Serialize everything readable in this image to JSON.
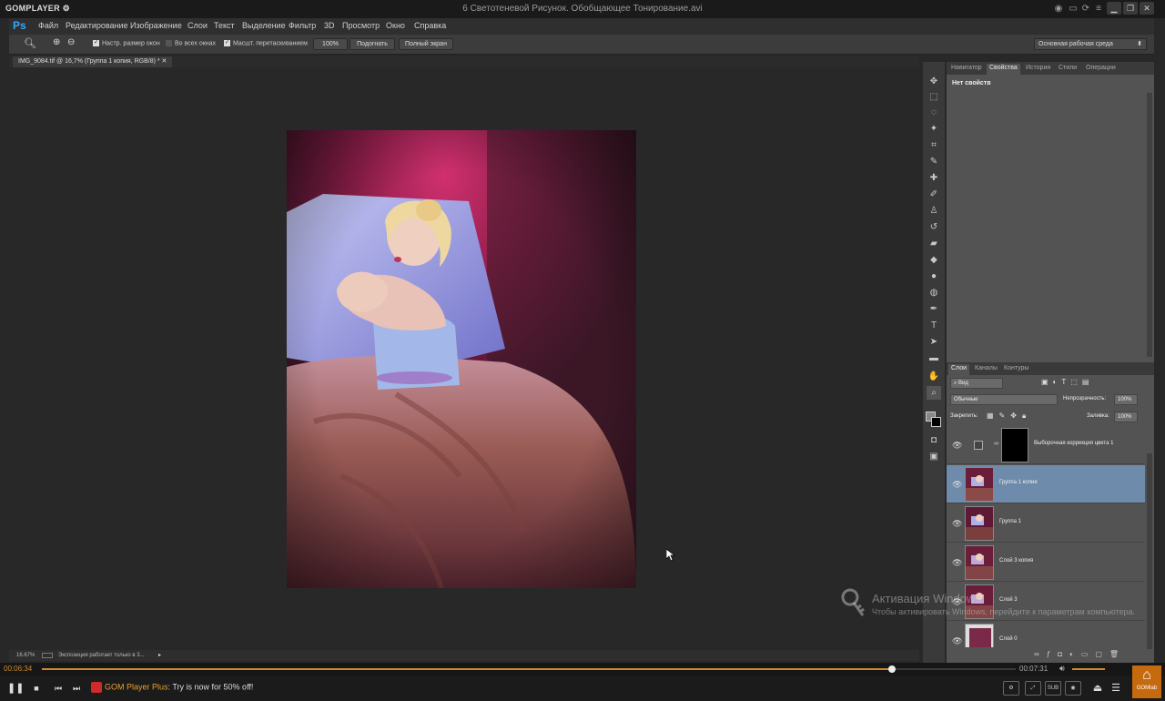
{
  "gom": {
    "logo": "GOMPLAYER ⚙",
    "file_title": "6 Светотеневой Рисунок. Обобщающее Тонирование.avi",
    "time_current": "00:06:34",
    "time_total": "00:07:31",
    "progress": 0.873,
    "promo_brand": "GOM Player Plus",
    "promo_text": ": Try is now for 50% off!",
    "gomlab_label": "GOMlab",
    "sub_label": "SUB"
  },
  "ps": {
    "logo": "Ps",
    "menu": [
      "Файл",
      "Редактирование",
      "Изображение",
      "Слои",
      "Текст",
      "Выделение",
      "Фильтр",
      "3D",
      "Просмотр",
      "Окно",
      "Справка"
    ],
    "options": {
      "resize_windows": "Настр. размер окон",
      "all_windows": "Во всех окнах",
      "scrubby_zoom": "Масшт. перетаскиванием",
      "zoom_100": "100%",
      "fit_screen": "Подогнать",
      "fill_screen": "Полный экран",
      "workspace": "Основная рабочая среда"
    },
    "doc_tab": "IMG_9084.tif @ 16,7% (Группа 1 копия, RGB/8) *",
    "status_zoom": "16.67%",
    "status_text": "Экспозиция работает только в 3...",
    "panel_tabs": [
      "Навигатор",
      "Свойства",
      "История",
      "Стили",
      "Операции"
    ],
    "no_props": "Нет свойств",
    "layers_tabs": [
      "Слои",
      "Каналы",
      "Контуры"
    ],
    "kind_filter": "Вид",
    "blend_mode": "Обычные",
    "opacity_label": "Непрозрачность:",
    "opacity_value": "100%",
    "lock_label": "Закрепить:",
    "fill_label": "Заливка:",
    "fill_value": "100%",
    "layers": [
      {
        "name": "Выборочная коррекция цвета 1",
        "active": false
      },
      {
        "name": "Группа 1 копия",
        "active": true
      },
      {
        "name": "Группа 1",
        "active": false
      },
      {
        "name": "Слой 3 копия",
        "active": false
      },
      {
        "name": "Слой 3",
        "active": false
      },
      {
        "name": "Слой 0",
        "active": false
      }
    ]
  },
  "watermark": {
    "title": "Активация Windows",
    "subtitle": "Чтобы активировать Windows, перейдите к параметрам компьютера."
  }
}
